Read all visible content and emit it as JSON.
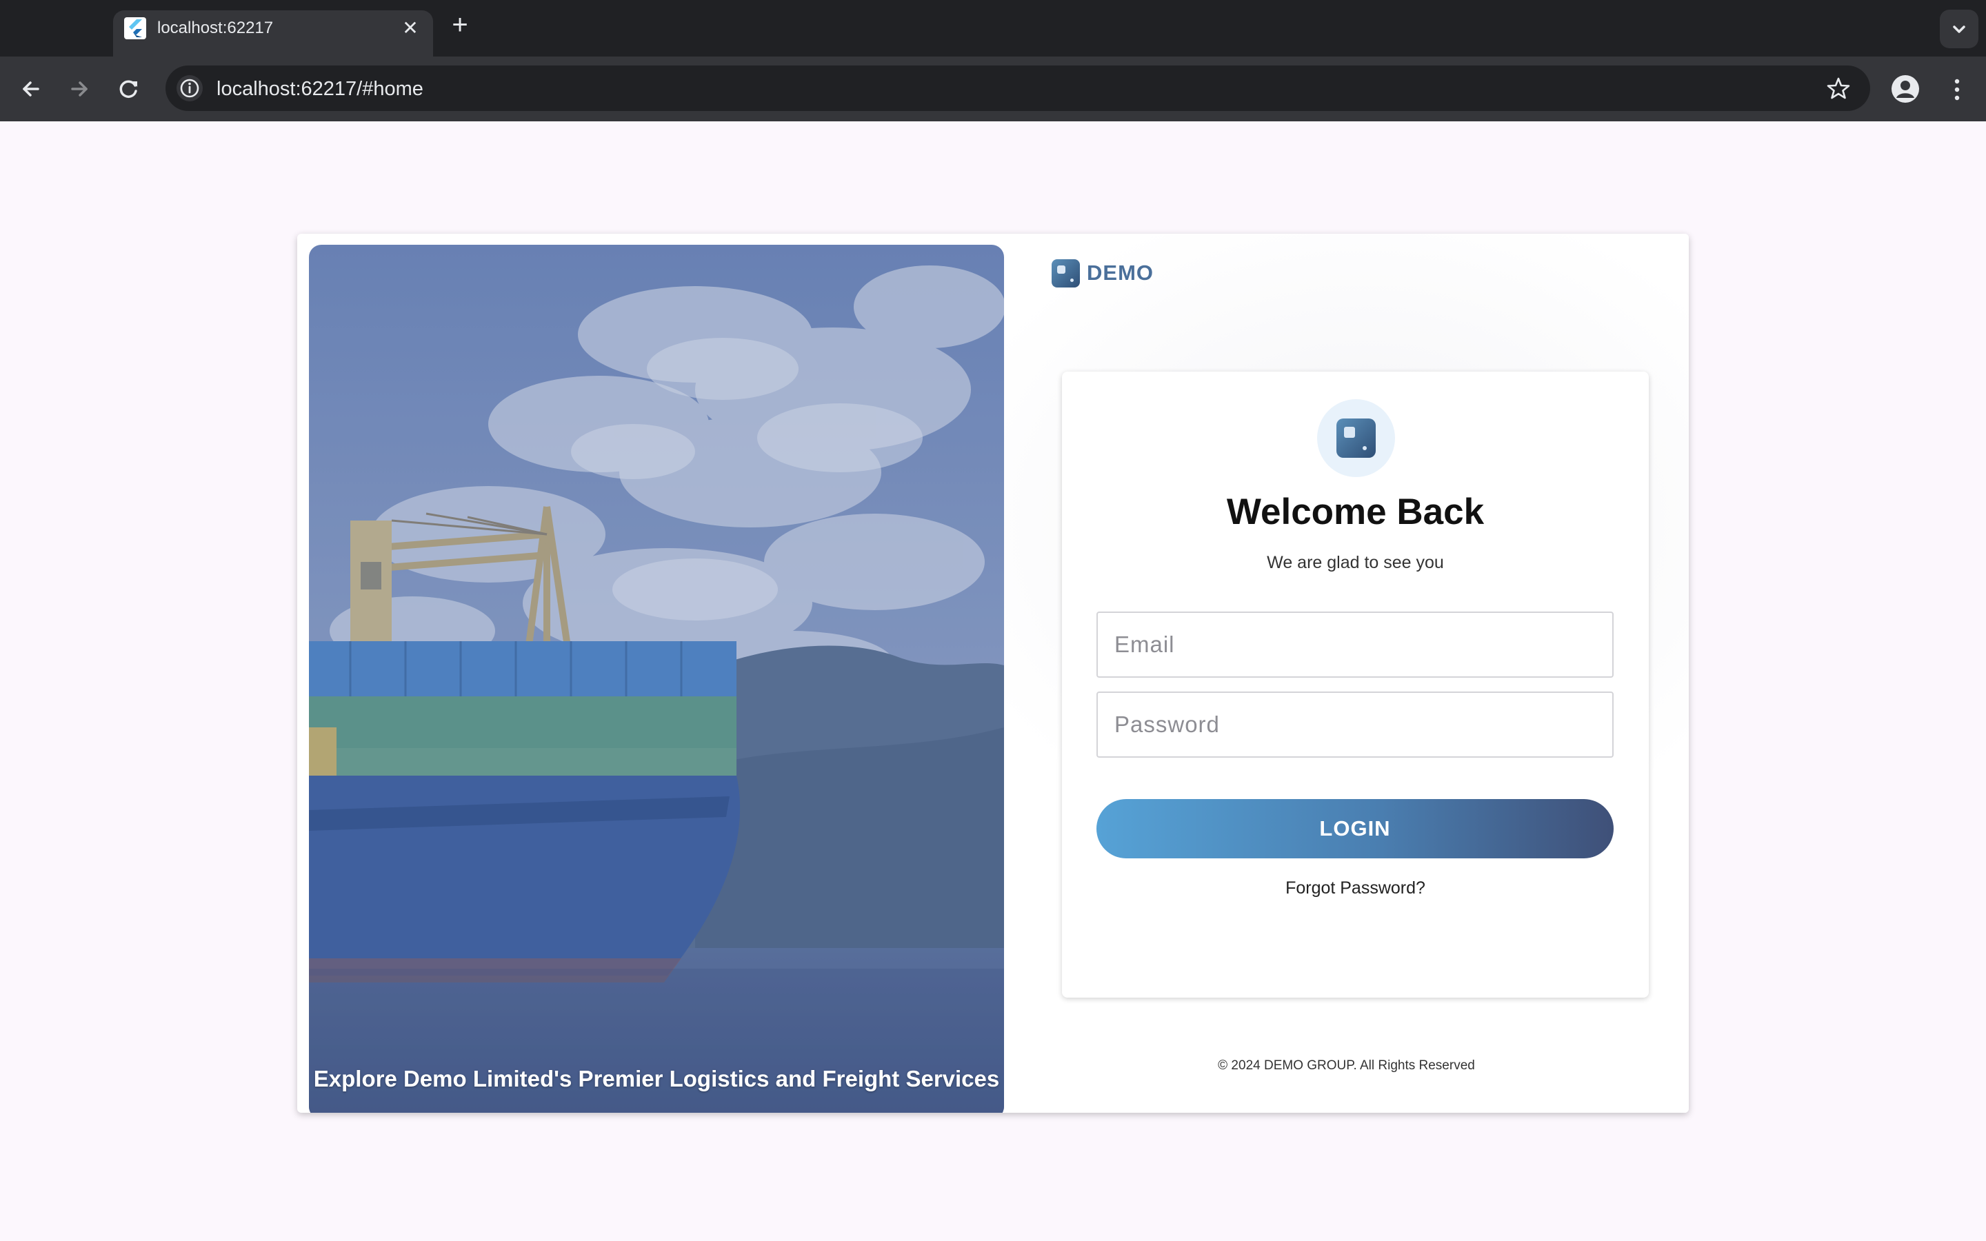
{
  "browser": {
    "tab_title": "localhost:62217",
    "tab_close": "✕",
    "new_tab": "+",
    "url": "localhost:62217/#home"
  },
  "page": {
    "brand": "DEMO",
    "hero_caption": "Explore Demo Limited's Premier Logistics and Freight Services",
    "login": {
      "title": "Welcome Back",
      "subtitle": "We are glad to see you",
      "email_placeholder": "Email",
      "password_placeholder": "Password",
      "login_button": "LOGIN",
      "forgot_password": "Forgot Password?"
    },
    "footer": "© 2024 DEMO GROUP. All Rights Reserved"
  },
  "colors": {
    "accent_start": "#56a2d6",
    "accent_end": "#3f5078",
    "brand": "#4a6f9a",
    "page_bg": "#fcf7fd"
  },
  "icons": [
    "flutter-favicon",
    "close-icon",
    "plus-icon",
    "chevron-down-icon",
    "back-arrow-icon",
    "forward-arrow-icon",
    "reload-icon",
    "info-icon",
    "star-icon",
    "profile-icon",
    "more-vert-icon",
    "demo-logo-icon"
  ]
}
